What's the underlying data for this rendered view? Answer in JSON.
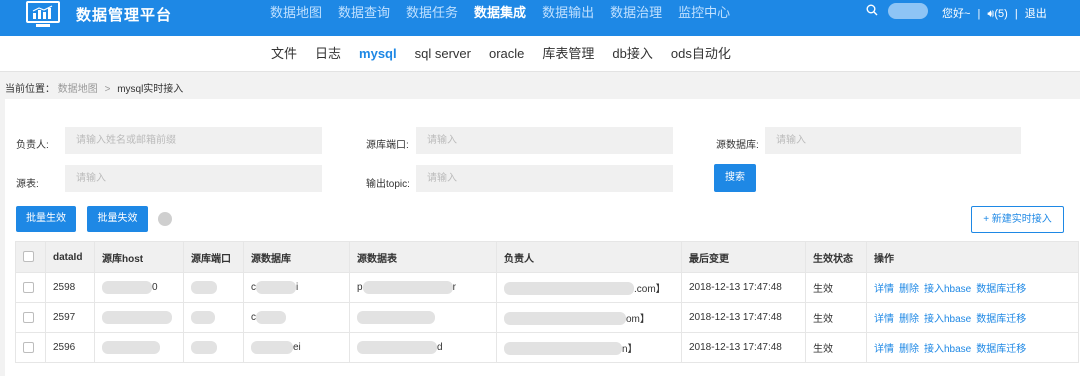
{
  "app": {
    "title": "数据管理平台"
  },
  "colors": {
    "primary": "#1e88e5",
    "panel": "#ffffff",
    "background": "#f2f2f2"
  },
  "main_nav": [
    {
      "label": "数据地图",
      "active": false
    },
    {
      "label": "数据查询",
      "active": false
    },
    {
      "label": "数据任务",
      "active": false
    },
    {
      "label": "数据集成",
      "active": true
    },
    {
      "label": "数据输出",
      "active": false
    },
    {
      "label": "数据治理",
      "active": false
    },
    {
      "label": "监控中心",
      "active": false
    }
  ],
  "header": {
    "search_icon": "search-icon",
    "greeting": "您好~",
    "sep1": "|",
    "messages": "(5)",
    "sep2": "|",
    "logout": "退出"
  },
  "sub_nav": [
    {
      "label": "文件",
      "active": false
    },
    {
      "label": "日志",
      "active": false
    },
    {
      "label": "mysql",
      "active": true
    },
    {
      "label": "sql server",
      "active": false
    },
    {
      "label": "oracle",
      "active": false
    },
    {
      "label": "库表管理",
      "active": false
    },
    {
      "label": "db接入",
      "active": false
    },
    {
      "label": "ods自动化",
      "active": false
    }
  ],
  "breadcrumb": {
    "prefix": "当前位置：",
    "level1": "数据地图",
    "sep": ">",
    "current": "mysql实时接入"
  },
  "filters": {
    "owner": {
      "label": "负责人:",
      "placeholder": "请输入姓名或邮箱前缀"
    },
    "source_port": {
      "label": "源库端口:",
      "placeholder": "请输入"
    },
    "source_db": {
      "label": "源数据库:",
      "placeholder": "请输入"
    },
    "source_table": {
      "label": "源表:",
      "placeholder": "请输入"
    },
    "output_topic": {
      "label": "输出topic:",
      "placeholder": "请输入"
    },
    "search_button": "搜索"
  },
  "actions": {
    "batch_enable": "批量生效",
    "batch_disable": "批量失效",
    "new_realtime": "+ 新建实时接入"
  },
  "table": {
    "columns": [
      "dataId",
      "源库host",
      "源库端口",
      "源数据库",
      "源数据表",
      "负责人",
      "最后变更",
      "生效状态",
      "操作"
    ],
    "operations": [
      "详情",
      "删除",
      "接入hbase",
      "数据库迁移"
    ],
    "rows": [
      {
        "dataId": "2598",
        "host_tail": "0",
        "db_text": "c",
        "db_tail": "i",
        "table_text": "p",
        "table_tail": "r",
        "owner_tail": ".com】",
        "last_change": "2018-12-13 17:47:48",
        "status": "生效"
      },
      {
        "dataId": "2597",
        "host_tail": "",
        "db_text": "c",
        "db_tail": "",
        "table_text": "",
        "table_tail": "",
        "owner_tail": "om】",
        "last_change": "2018-12-13 17:47:48",
        "status": "生效"
      },
      {
        "dataId": "2596",
        "host_tail": "",
        "db_text": "",
        "db_tail": "ei",
        "table_text": "",
        "table_tail": "d",
        "owner_tail": "n】",
        "last_change": "2018-12-13 17:47:48",
        "status": "生效"
      }
    ]
  }
}
